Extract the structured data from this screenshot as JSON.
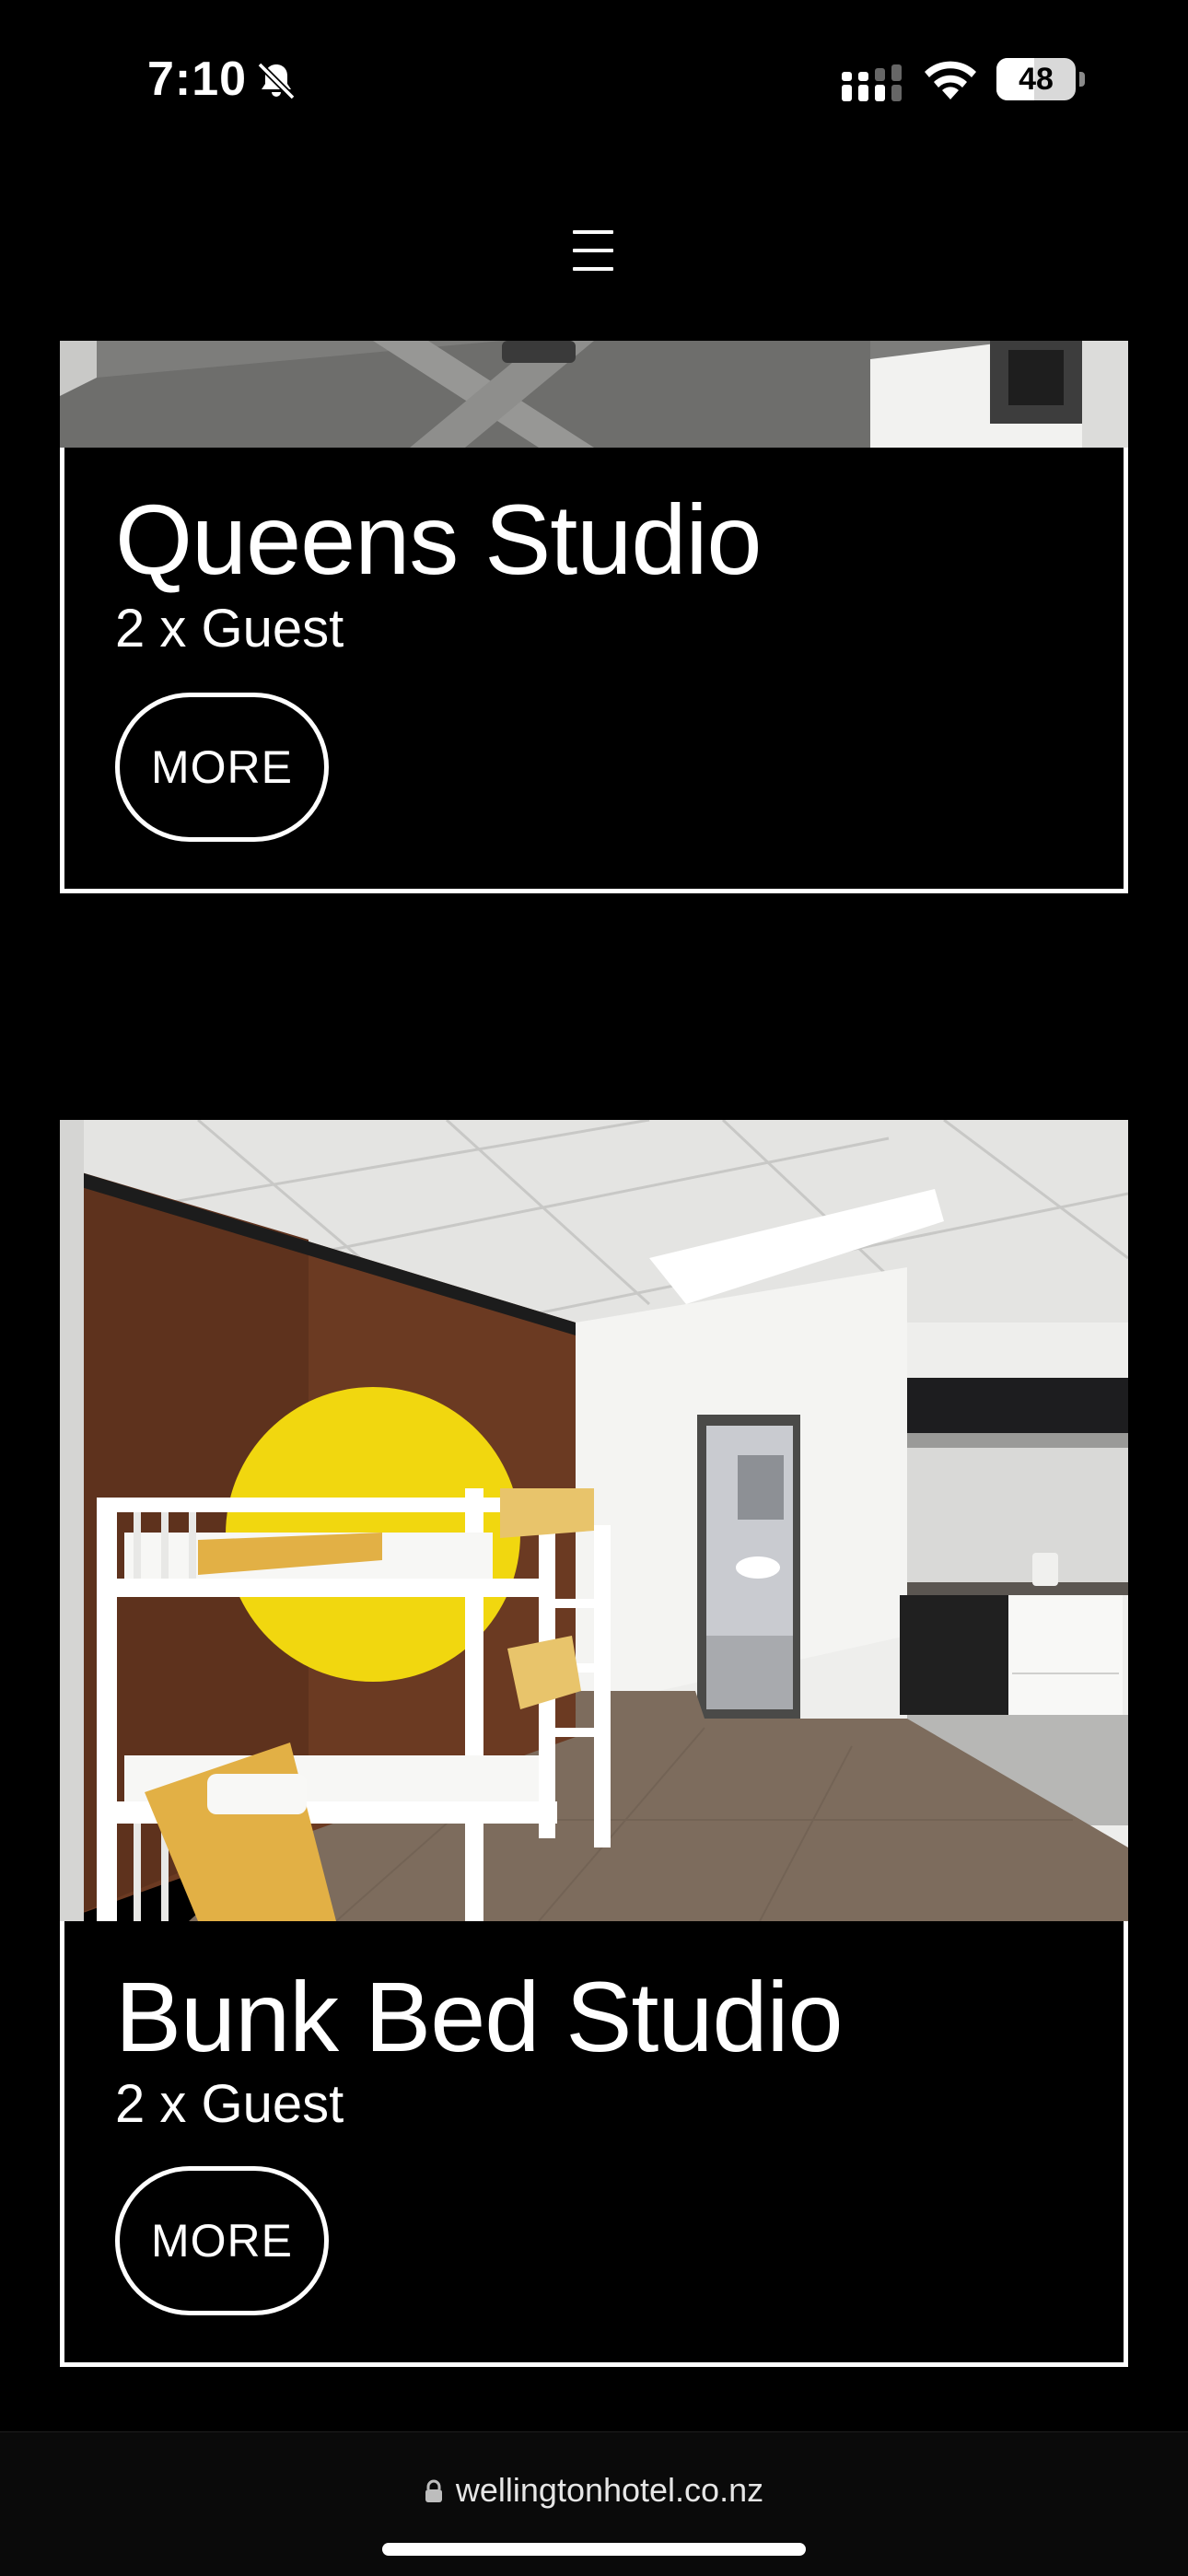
{
  "status_bar": {
    "time": "7:10",
    "battery_level": "48",
    "battery_fraction": 0.48,
    "icons": [
      "bell-slash-icon",
      "cellular-signal-icon",
      "wifi-icon",
      "battery-icon"
    ]
  },
  "header": {
    "menu_icon": "☰"
  },
  "rooms": [
    {
      "title": "Queens Studio",
      "capacity": "2 x Guest",
      "more_label": "MORE"
    },
    {
      "title": "Bunk Bed Studio",
      "capacity": "2 x Guest",
      "more_label": "MORE"
    }
  ],
  "browser": {
    "url": "wellingtonhotel.co.nz"
  },
  "colors": {
    "background": "#000000",
    "foreground": "#ffffff",
    "accent_yellow": "#f1d70f",
    "wall_wood": "#6b3a22"
  }
}
